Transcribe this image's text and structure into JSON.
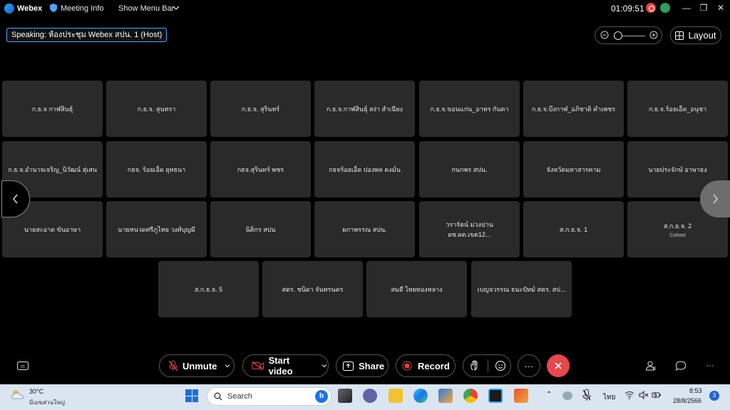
{
  "titlebar": {
    "app_name": "Webex",
    "meeting_info": "Meeting Info",
    "show_menu_bar": "Show Menu Bar",
    "time": "01:09:51",
    "minimize": "—",
    "restore": "❐",
    "close": "✕"
  },
  "speaking": "Speaking: ห้องประชุม Webex สปน. 1 (Host)",
  "layout_label": "Layout",
  "zoom_level": 0.0,
  "participants": [
    {
      "name": "ก.ธ.จ กาฬสินธุ์"
    },
    {
      "name": "ก.ธ.จ. สุนทรา"
    },
    {
      "name": "ก.ธ.จ. สุรินทร์"
    },
    {
      "name": "ก.ธ.จ.กาฬสินธุ์ สง่า สำเนียง"
    },
    {
      "name": "ก.ธ.จ.ขอนแก่น_อาทร กันตา"
    },
    {
      "name": "ก.ธ.จ.บึงกาฬ_อภิชาติ คำเพชร"
    },
    {
      "name": "ก.ธ.จ.ร้อยเอ็ด_อนุชา"
    },
    {
      "name": "ก.ธ.จ.อำนาจเจริญ_นิวัฒน์ สุ่เสน"
    },
    {
      "name": "กธจ. ร้อยเอ็ด ยุทธนา"
    },
    {
      "name": "กธจ.สุรินทร์ พชร"
    },
    {
      "name": "กธจร้อยเอ็ด ปองพล คงมั่น"
    },
    {
      "name": "กนกพร สปน."
    },
    {
      "name": "จังหวัดมหาสารคาม"
    },
    {
      "name": "นายประจักษ์ อาษาธง"
    },
    {
      "name": "นายสะอาด ขันอาษา"
    },
    {
      "name": "นายหนวดศรีภูไทย วงศ์บุญมี"
    },
    {
      "name": "นิติกร สปน"
    },
    {
      "name": "ผกาพรรณ สปน."
    },
    {
      "name": "วรารัตน์ ม่วงปาน ผช.ผต.เขต12..."
    },
    {
      "name": "ส.ก.ธ.จ. 1"
    },
    {
      "name": "ส.ก.ธ.จ. 2",
      "role": "Cohost"
    },
    {
      "name": "ส.ก.ธ.จ. 5"
    },
    {
      "name": "สตร. ชนิดา จันทรนคร"
    },
    {
      "name": "สมดี ไทยทองหลาง"
    },
    {
      "name": "เบญจวรรณ ธนะปัทม์ สตร. สป..."
    }
  ],
  "controls": {
    "unmute": "Unmute",
    "start_video": "Start video",
    "share": "Share",
    "record": "Record",
    "more": "···"
  },
  "taskbar": {
    "temperature": "30°C",
    "weather_desc": "มีเมฆส่วนใหญ่",
    "search_placeholder": "Search",
    "language": "ไทย",
    "clock_time": "8:53",
    "clock_date": "28/8/2566",
    "notifications": "3"
  },
  "colors": {
    "end_call": "#e5484d",
    "tile_bg": "#2a2a2a",
    "speaking_border": "#4da3ff",
    "record_red": "#e0453d",
    "taskbar_bg": "#dbe5f1"
  }
}
